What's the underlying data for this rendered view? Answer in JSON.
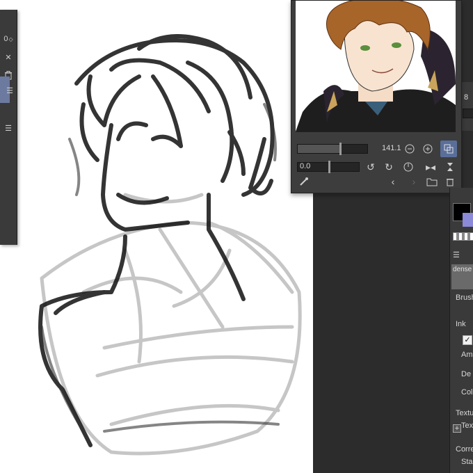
{
  "navigator": {
    "zoom_value": "141.1",
    "rotation_value": "0.0"
  },
  "left_panel": {
    "value_fragment": "0"
  },
  "edge_panel": {
    "value_fragment": "8"
  },
  "properties": {
    "brush_name": "dense",
    "labels": {
      "brush": "Brush",
      "ink": "Ink",
      "amount": "Am",
      "density": "De",
      "color": "Col",
      "texture": "Textu",
      "texture_sub": "Text",
      "correction": "Corre",
      "stabilization": "Stab"
    },
    "ink_checked_mark": "✓"
  },
  "colors": {
    "main_color": "#000000",
    "sub_color": "#8a8ad8",
    "accent_selected": "#6c7aa0"
  },
  "icons": [
    "zoom-out-icon",
    "zoom-in-icon",
    "fit-icon",
    "rotate-left-icon",
    "rotate-right-icon",
    "reset-rotation-icon",
    "flip-horizontal-icon",
    "flip-vertical-icon",
    "eyedropper-icon",
    "prev-icon",
    "next-icon",
    "folder-icon",
    "trash-icon"
  ]
}
